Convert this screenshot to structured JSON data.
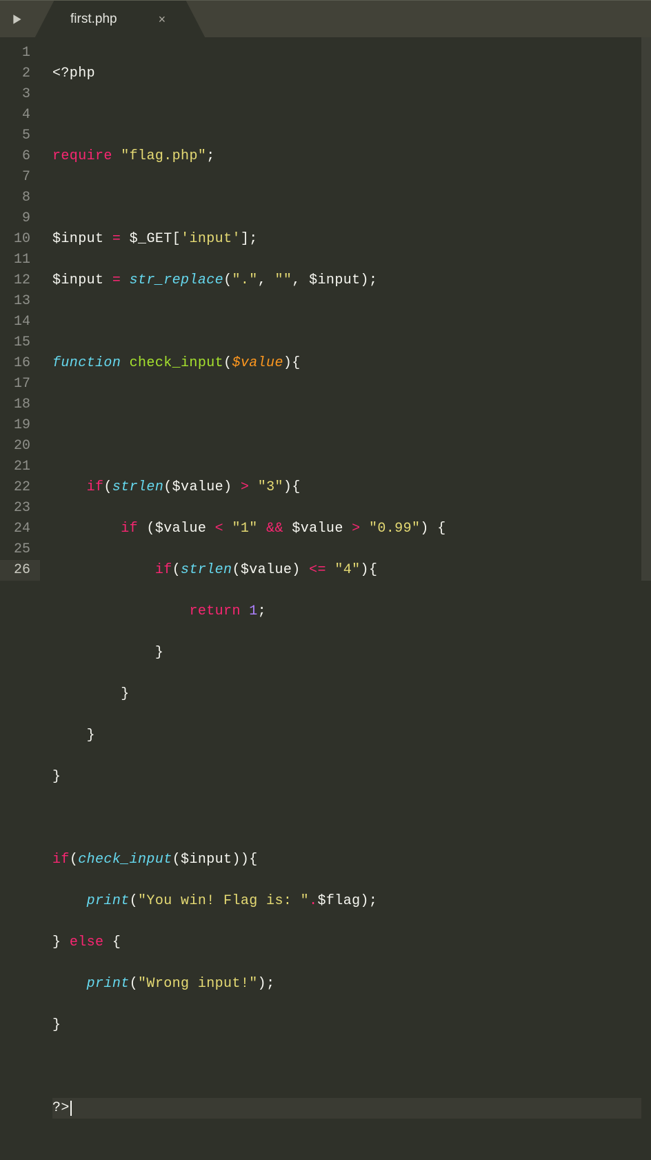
{
  "tab": {
    "filename": "first.php",
    "close_glyph": "×"
  },
  "gutter": {
    "lines": [
      "1",
      "2",
      "3",
      "4",
      "5",
      "6",
      "7",
      "8",
      "9",
      "10",
      "11",
      "12",
      "13",
      "14",
      "15",
      "16",
      "17",
      "18",
      "19",
      "20",
      "21",
      "22",
      "23",
      "24",
      "25",
      "26"
    ],
    "current_line": 26
  },
  "code": {
    "l1_open": "<?php",
    "l3_kw": "require",
    "l3_str": "\"flag.php\"",
    "l3_end": ";",
    "l5_var": "$input",
    "l5_eq": " = ",
    "l5_get": "$_GET",
    "l5_br1": "[",
    "l5_str": "'input'",
    "l5_br2": "];",
    "l6_var": "$input",
    "l6_eq": " = ",
    "l6_fn": "str_replace",
    "l6_p1": "(",
    "l6_s1": "\".\"",
    "l6_c1": ", ",
    "l6_s2": "\"\"",
    "l6_c2": ", ",
    "l6_v2": "$input",
    "l6_p2": ");",
    "l8_kw": "function",
    "l8_name": " check_input",
    "l8_p1": "(",
    "l8_param": "$value",
    "l8_p2": "){",
    "l11_pre": "    ",
    "l11_if": "if",
    "l11_p1": "(",
    "l11_fn": "strlen",
    "l11_p2": "(",
    "l11_var": "$value",
    "l11_p3": ") ",
    "l11_op": ">",
    "l11_sp": " ",
    "l11_str": "\"3\"",
    "l11_p4": "){",
    "l12_pre": "        ",
    "l12_if": "if",
    "l12_p1": " (",
    "l12_var1": "$value",
    "l12_sp1": " ",
    "l12_op1": "<",
    "l12_sp2": " ",
    "l12_s1": "\"1\"",
    "l12_sp3": " ",
    "l12_and": "&&",
    "l12_sp4": " ",
    "l12_var2": "$value",
    "l12_sp5": " ",
    "l12_op2": ">",
    "l12_sp6": " ",
    "l12_s2": "\"0.99\"",
    "l12_p2": ") {",
    "l13_pre": "            ",
    "l13_if": "if",
    "l13_p1": "(",
    "l13_fn": "strlen",
    "l13_p2": "(",
    "l13_var": "$value",
    "l13_p3": ") ",
    "l13_op": "<=",
    "l13_sp": " ",
    "l13_str": "\"4\"",
    "l13_p4": "){",
    "l14_pre": "                ",
    "l14_ret": "return",
    "l14_sp": " ",
    "l14_num": "1",
    "l14_end": ";",
    "l15_pre": "            ",
    "l15_cb": "}",
    "l16_pre": "        ",
    "l16_cb": "}",
    "l17_pre": "    ",
    "l17_cb": "}",
    "l18_cb": "}",
    "l20_if": "if",
    "l20_p1": "(",
    "l20_fn": "check_input",
    "l20_p2": "(",
    "l20_var": "$input",
    "l20_p3": ")){",
    "l21_pre": "    ",
    "l21_fn": "print",
    "l21_p1": "(",
    "l21_str": "\"You win! Flag is: \"",
    "l21_dot": ".",
    "l21_var": "$flag",
    "l21_p2": ");",
    "l22_pre": "",
    "l22_cb": "} ",
    "l22_else": "else",
    "l22_ob": " {",
    "l23_pre": "    ",
    "l23_fn": "print",
    "l23_p1": "(",
    "l23_str": "\"Wrong input!\"",
    "l23_p2": ");",
    "l24_pre": "",
    "l24_cb": "}",
    "l26_close": "?>"
  }
}
